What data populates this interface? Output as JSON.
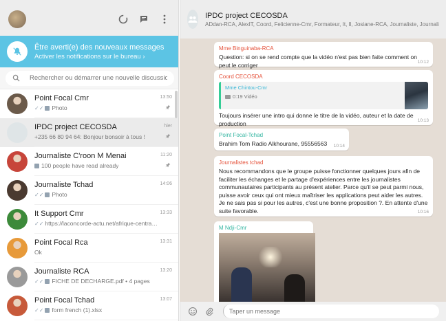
{
  "left_header": {
    "status_icon": "status-icon",
    "new_chat_icon": "new-chat-icon",
    "menu_icon": "menu-icon"
  },
  "notification": {
    "title": "Être averti(e) des nouveaux messages",
    "subtitle": "Activer les notifications sur le bureau ›"
  },
  "search": {
    "placeholder": "Rechercher ou démarrer une nouvelle discussion"
  },
  "chats": [
    {
      "name": "Point Focal Cmr",
      "preview": "Photo",
      "time": "13:50",
      "pinned": true,
      "ticks": "✓✓",
      "has_media": true,
      "avatar_color": "#6b5a4a"
    },
    {
      "name": "IPDC project CECOSDA",
      "preview": "+235 66 80 94 64: Bonjour bonsoir à tous !",
      "time": "hier",
      "pinned": true,
      "ticks": "",
      "has_media": false,
      "avatar_color": "#dfe5e7"
    },
    {
      "name": "Journaliste C'roon M Menai",
      "preview": "100 people have read already",
      "time": "11:20",
      "pinned": true,
      "ticks": "",
      "has_media": true,
      "avatar_color": "#c7453a"
    },
    {
      "name": "Journaliste Tchad",
      "preview": "Photo",
      "time": "14:06",
      "pinned": false,
      "ticks": "✓✓",
      "has_media": true,
      "avatar_color": "#4a3a30"
    },
    {
      "name": "It Support Cmr",
      "preview": "https://laconcorde-actu.net/afrique-centrale-co...",
      "time": "13:33",
      "pinned": false,
      "ticks": "✓✓",
      "has_media": false,
      "avatar_color": "#3d8a3a"
    },
    {
      "name": "Point Focal Rca",
      "preview": "Ok",
      "time": "13:31",
      "pinned": false,
      "ticks": "",
      "has_media": false,
      "avatar_color": "#e79a3a"
    },
    {
      "name": "Journaliste RCA",
      "preview": "FICHE DE DECHARGE.pdf • 4 pages",
      "time": "13:20",
      "pinned": false,
      "ticks": "✓✓",
      "has_media": true,
      "avatar_color": "#9a9a9a"
    },
    {
      "name": "Point Focal Tchad",
      "preview": "form french (1).xlsx",
      "time": "13:07",
      "pinned": false,
      "ticks": "✓✓",
      "has_media": true,
      "avatar_color": "#c75a3a"
    }
  ],
  "conversation": {
    "group_name": "IPDC project CECOSDA",
    "members": "ADdan-RCA, AlexIT, Coord, Felicienne-Cmr, Formateur, It, Il, Josiane-RCA, Journaliste, Journaliste, Journ"
  },
  "messages": [
    {
      "sender": "Mme Binguinaba-RCA",
      "sender_color": "#e5533c",
      "text": "Question: si on se rend compte que la vidéo n'est pas bien faite comment on peut le corriger",
      "time": "10:12"
    },
    {
      "sender": "Coord CECOSDA",
      "sender_color": "#e5533c",
      "quote_sender": "Mme Chintou-Cmr",
      "quote_text": "0:19 Vidéo",
      "text": "Toujours insérer une intro qui donne le titre de la vidéo, auteur et la date de production",
      "time": "10:13"
    },
    {
      "sender": "Point Focal-Tchad",
      "sender_color": "#35b6a2",
      "text": "Brahim Tom Radio Alkhourane, 95556563",
      "time": "10:14"
    },
    {
      "sender": "Journalistes tchad",
      "sender_color": "#e5533c",
      "text": "Nous recommandons que le groupe puisse fonctionner quelques jours afin de faciliter les échanges et le partage d'expériences entre les journalistes communautaires participants au présent atelier. Parce qu'il se peut parmi nous, puisse avoir ceux qui ont mieux maîtriser les applications peut aider les autres. Je ne sais pas si pour les autres, c'est une bonne proposition ?. En attente d'une suite favorable.",
      "time": "10:16"
    },
    {
      "sender": "M Ndji-Cmr",
      "sender_color": "#35b6a2",
      "text": "",
      "time": ""
    }
  ],
  "composer": {
    "placeholder": "Taper un message",
    "emoji_icon": "emoji-icon",
    "attach_icon": "attach-icon"
  }
}
